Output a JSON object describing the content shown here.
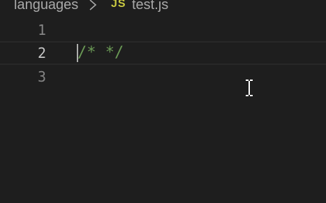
{
  "breadcrumb": {
    "folder": "languages",
    "separator_icon": "chevron-right-icon",
    "file_icon_label": "JS",
    "file_name": "test.js"
  },
  "editor": {
    "lines": [
      {
        "number": "1",
        "text": ""
      },
      {
        "number": "2",
        "text": "/* */"
      },
      {
        "number": "3",
        "text": ""
      }
    ],
    "current_line": "2"
  },
  "colors": {
    "background": "#1e1e1e",
    "js_icon": "#cbcb41",
    "comment": "#6a9955"
  }
}
